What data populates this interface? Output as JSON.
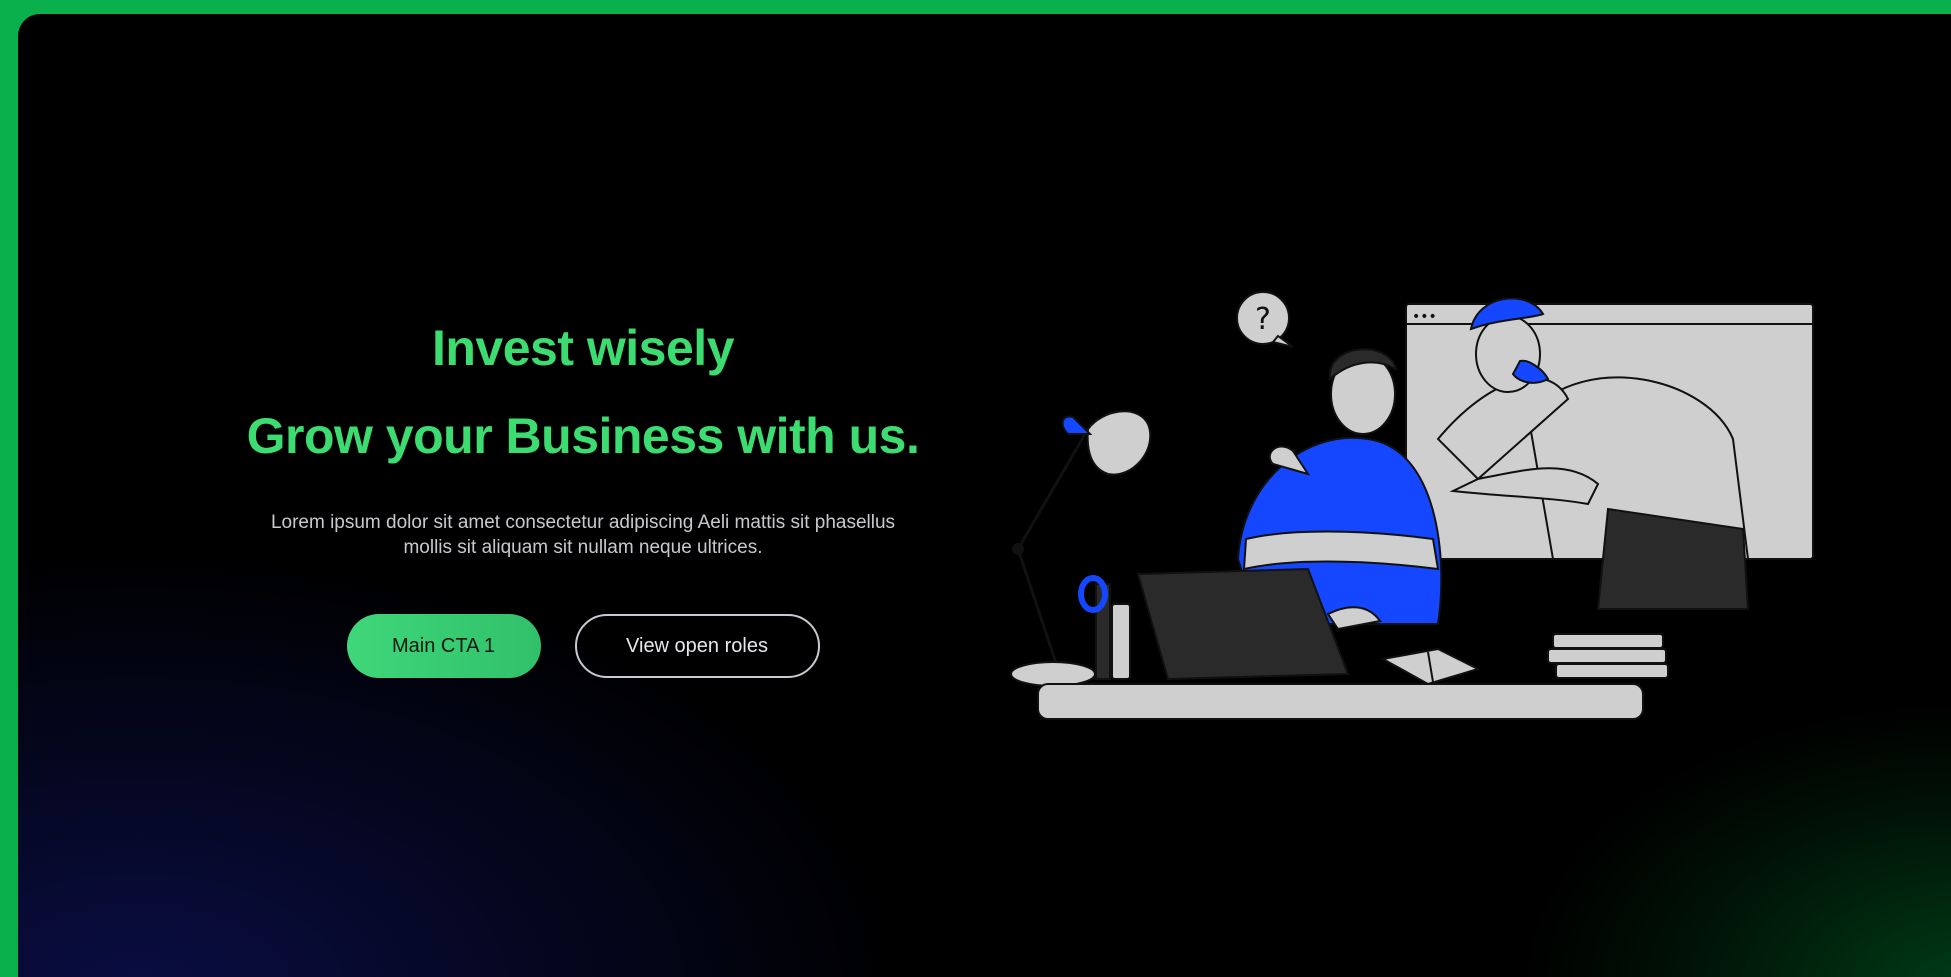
{
  "hero": {
    "headline_line1": "Invest wisely",
    "headline_line2": "Grow your Business with us.",
    "description": "Lorem ipsum dolor sit amet consectetur adipiscing Aeli mattis sit phasellus mollis sit aliquam sit nullam neque ultrices.",
    "primary_cta_label": "Main CTA 1",
    "secondary_cta_label": "View open roles"
  },
  "illustration": {
    "bubble_text": "?",
    "browser_dots": "•••",
    "icons": [
      "question-bubble-icon",
      "desk-lamp-icon",
      "laptop-icon",
      "book-icon"
    ]
  },
  "colors": {
    "accent_green": "#3ddc71",
    "frame_green": "#0ab04c",
    "illustration_blue": "#1447ff",
    "illustration_grey": "#cfcfcf",
    "background": "#000000"
  }
}
